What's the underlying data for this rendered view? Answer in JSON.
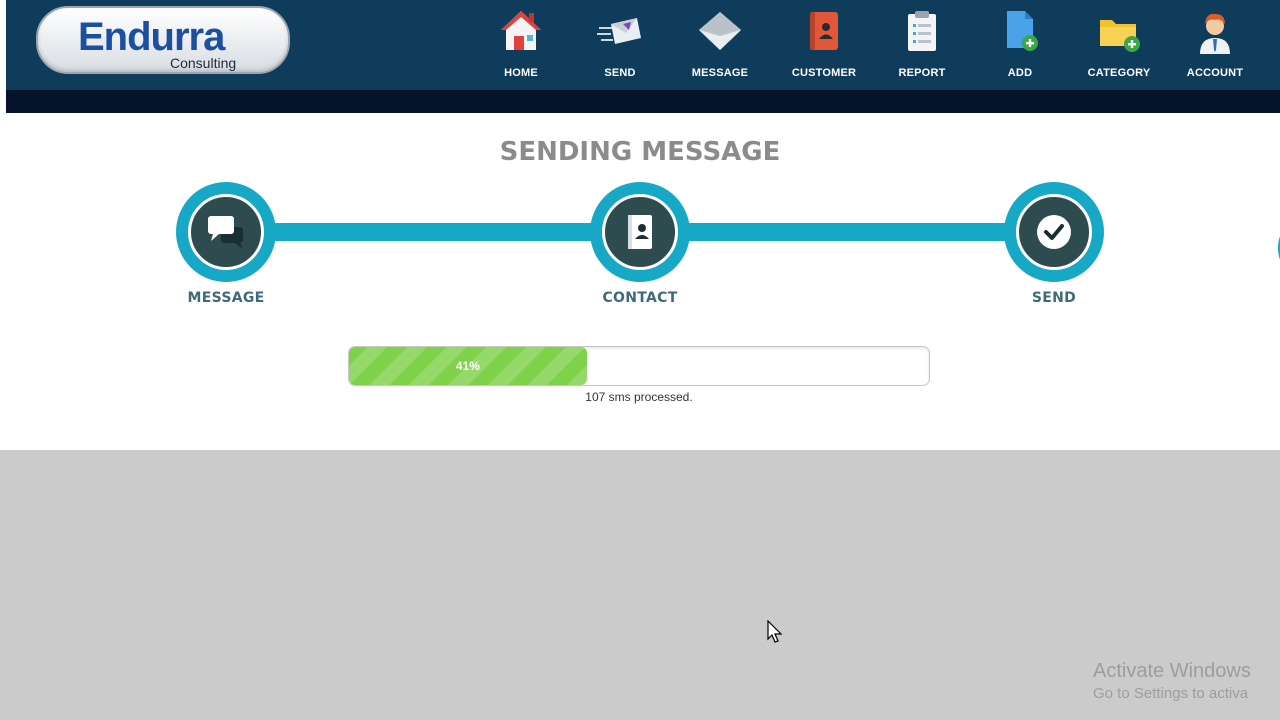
{
  "brand": {
    "logo_main": "Endurra",
    "logo_sub": "Consulting"
  },
  "nav": {
    "items": [
      {
        "label": "HOME",
        "icon": "home-icon"
      },
      {
        "label": "SEND",
        "icon": "send-icon"
      },
      {
        "label": "MESSAGE",
        "icon": "envelope-icon"
      },
      {
        "label": "CUSTOMER",
        "icon": "contact-book-icon"
      },
      {
        "label": "REPORT",
        "icon": "clipboard-icon"
      },
      {
        "label": "ADD",
        "icon": "add-file-icon"
      },
      {
        "label": "CATEGORY",
        "icon": "add-folder-icon"
      },
      {
        "label": "ACCOUNT",
        "icon": "user-icon"
      }
    ]
  },
  "main": {
    "title": "SENDING MESSAGE",
    "steps": [
      {
        "label": "MESSAGE",
        "icon": "chat-bubble-icon"
      },
      {
        "label": "CONTACT",
        "icon": "contact-card-icon"
      },
      {
        "label": "SEND",
        "icon": "checkmark-icon"
      }
    ],
    "progress": {
      "percent": 41,
      "label": "41%",
      "caption": "107 sms processed."
    }
  },
  "watermark": {
    "title": "Activate Windows",
    "subtitle": "Go to Settings to activa"
  },
  "colors": {
    "header": "#0f3c5b",
    "accent": "#17a8c6",
    "progress": "#7fd14a",
    "step_inner": "#2e4b4f"
  }
}
